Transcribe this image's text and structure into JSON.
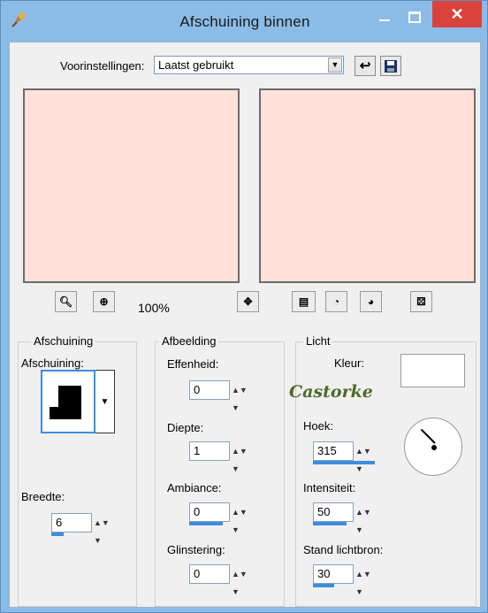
{
  "window": {
    "title": "Afschuining binnen",
    "close_glyph": "✕"
  },
  "presets": {
    "label": "Voorinstellingen:",
    "value": "Laatst gebruikt"
  },
  "preview": {
    "zoom": "100%"
  },
  "groups": {
    "afschuining": {
      "title": "Afschuining",
      "bevel_label": "Afschuining:",
      "width_label": "Breedte:",
      "width_value": "6"
    },
    "afbeelding": {
      "title": "Afbeelding",
      "effenheid_label": "Effenheid:",
      "effenheid_value": "0",
      "diepte_label": "Diepte:",
      "diepte_value": "1",
      "ambiance_label": "Ambiance:",
      "ambiance_value": "0",
      "glinstering_label": "Glinstering:",
      "glinstering_value": "0"
    },
    "licht": {
      "title": "Licht",
      "kleur_label": "Kleur:",
      "hoek_label": "Hoek:",
      "hoek_value": "315",
      "intensiteit_label": "Intensiteit:",
      "intensiteit_value": "50",
      "stand_label": "Stand lichtbron:",
      "stand_value": "30"
    }
  },
  "watermark": "Castorke",
  "colors": {
    "preview_fill": "#ffe1d9",
    "accent": "#3c8ee0",
    "close": "#d9433c"
  }
}
